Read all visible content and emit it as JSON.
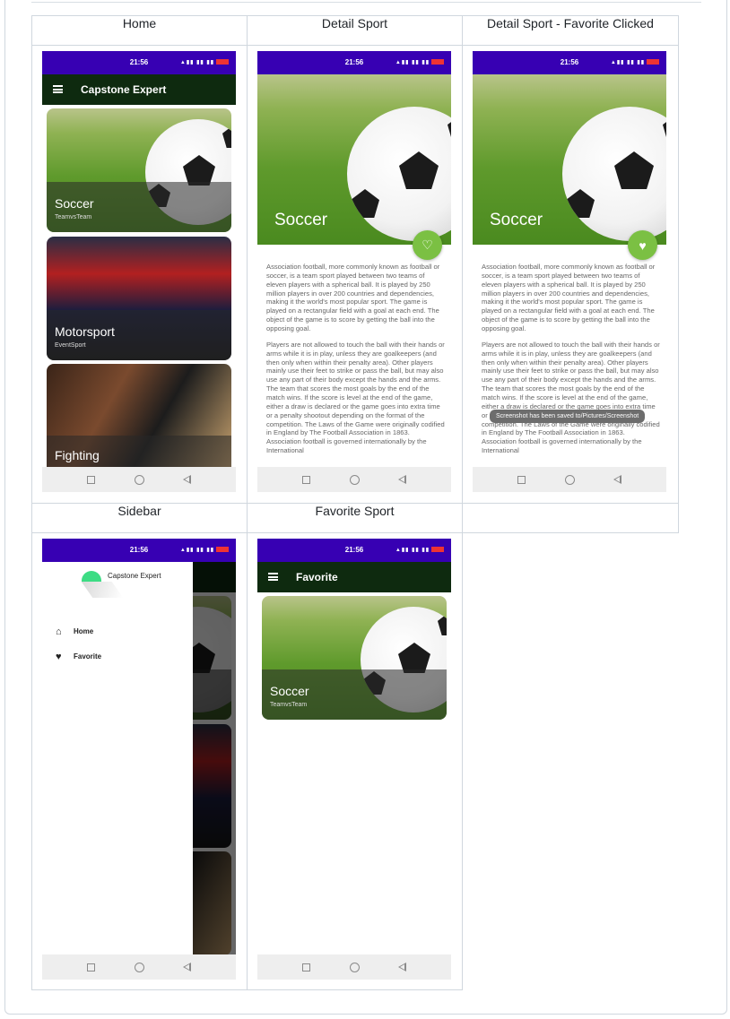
{
  "columns": {
    "home": "Home",
    "detail": "Detail Sport",
    "detail_fav": "Detail Sport - Favorite Clicked",
    "sidebar": "Sidebar",
    "favorite": "Favorite Sport"
  },
  "status": {
    "time": "21:56"
  },
  "home": {
    "app_title": "Capstone Expert",
    "cards": [
      {
        "title": "Soccer",
        "subtitle": "TeamvsTeam"
      },
      {
        "title": "Motorsport",
        "subtitle": "EventSport"
      },
      {
        "title": "Fighting",
        "subtitle": ""
      }
    ]
  },
  "detail": {
    "title": "Soccer",
    "paragraph1": "Association football, more commonly known as football or soccer, is a team sport played between two teams of eleven players with a spherical ball. It is played by 250 million players in over 200 countries and dependencies, making it the world's most popular sport. The game is played on a rectangular field with a goal at each end. The object of the game is to score by getting the ball into the opposing goal.",
    "paragraph2": "Players are not allowed to touch the ball with their hands or arms while it is in play, unless they are goalkeepers (and then only when within their penalty area). Other players mainly use their feet to strike or pass the ball, but may also use any part of their body except the hands and the arms. The team that scores the most goals by the end of the match wins. If the score is level at the end of the game, either a draw is declared or the game goes into extra time or a penalty shootout depending on the format of the competition. The Laws of the Game were originally codified in England by The Football Association in 1863. Association football is governed internationally by the International",
    "toast": "Screenshot has been saved to/Pictures/Screenshot"
  },
  "sidebar": {
    "brand": "Capstone Expert",
    "items": [
      {
        "label": "Home",
        "icon": "home-icon"
      },
      {
        "label": "Favorite",
        "icon": "heart-icon"
      }
    ]
  },
  "favorite": {
    "app_title": "Favorite",
    "cards": [
      {
        "title": "Soccer",
        "subtitle": "TeamvsTeam"
      }
    ]
  },
  "colors": {
    "status_bar": "#3700b3",
    "app_bar": "#0e2a0f",
    "fab": "#7bc043"
  }
}
